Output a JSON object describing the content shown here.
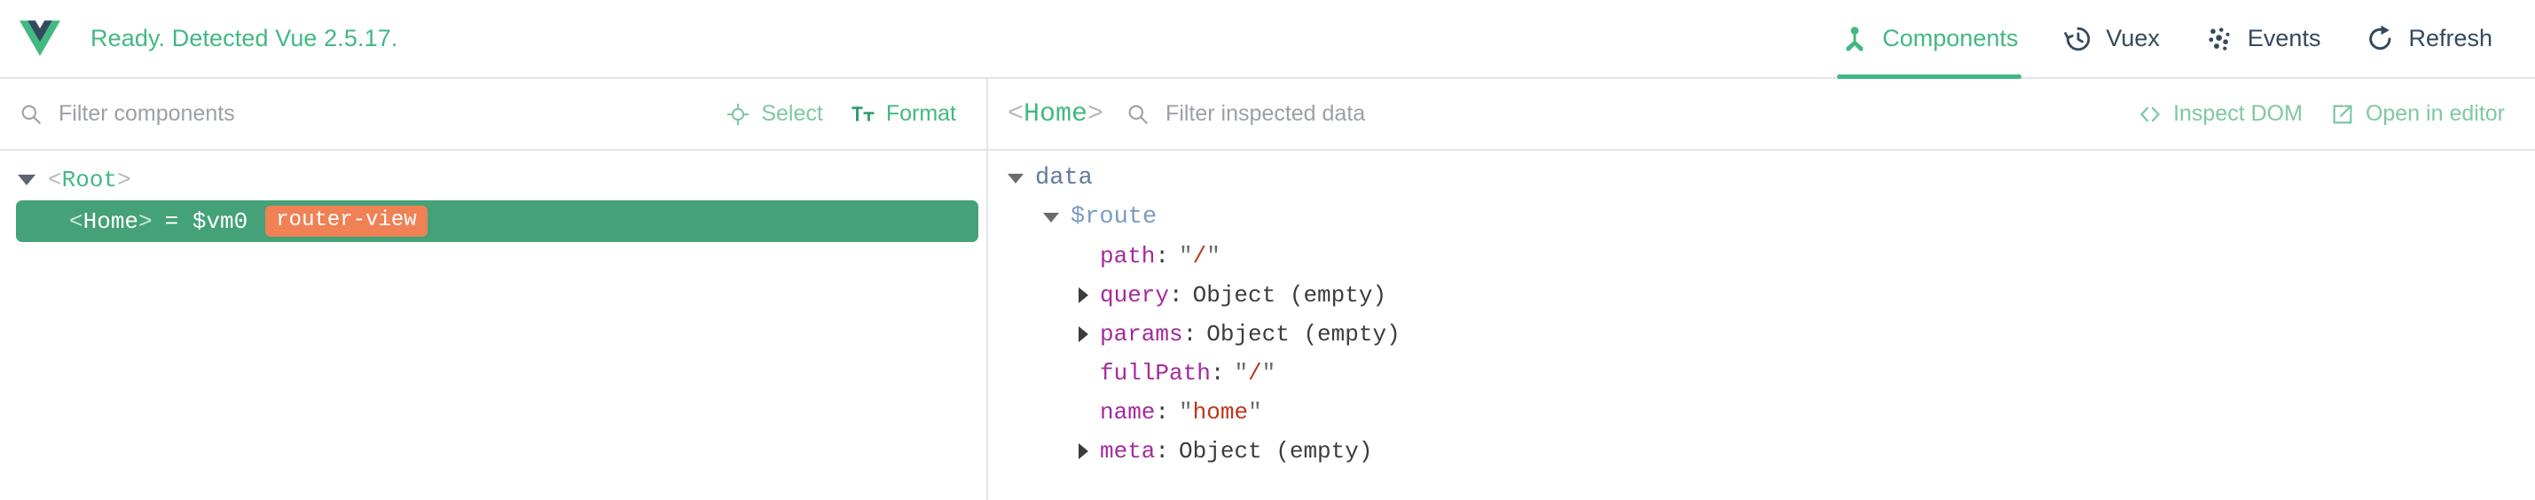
{
  "header": {
    "logo_icon": "vue-logo-icon",
    "status": "Ready. Detected Vue 2.5.17.",
    "tabs": [
      {
        "label": "Components",
        "icon": "component-tree-icon",
        "active": true
      },
      {
        "label": "Vuex",
        "icon": "history-clock-icon",
        "active": false
      },
      {
        "label": "Events",
        "icon": "pulse-dots-icon",
        "active": false
      },
      {
        "label": "Refresh",
        "icon": "refresh-icon",
        "active": false
      }
    ]
  },
  "left_panel": {
    "toolbar": {
      "search_icon": "search-icon",
      "search_placeholder": "Filter components",
      "search_value": "",
      "select_label": "Select",
      "select_icon": "target-crosshair-icon",
      "format_label": "Format",
      "format_icon": "text-format-icon"
    },
    "tree": [
      {
        "name": "Root",
        "open_tag": "<",
        "close_tag": ">",
        "expanded": true,
        "selected": false,
        "depth": 0,
        "vm": "",
        "badge": ""
      },
      {
        "name": "Home",
        "open_tag": "<",
        "close_tag": ">",
        "expanded": false,
        "selected": true,
        "depth": 1,
        "vm": "= $vm0",
        "badge": "router-view"
      }
    ]
  },
  "right_panel": {
    "toolbar": {
      "inspected_open": "<",
      "inspected_name": "Home",
      "inspected_close": ">",
      "search_icon": "search-icon",
      "search_placeholder": "Filter inspected data",
      "search_value": "",
      "inspect_dom_label": "Inspect DOM",
      "inspect_dom_icon": "code-brackets-icon",
      "open_in_editor_label": "Open in editor",
      "open_in_editor_icon": "external-link-icon"
    },
    "groups": [
      {
        "label": "data",
        "expanded": true
      },
      {
        "label": "$route",
        "expanded": true
      }
    ],
    "properties": [
      {
        "key": "path",
        "colon": ":",
        "value": "\"/\"",
        "raw": "/",
        "type": "string",
        "expandable": false
      },
      {
        "key": "query",
        "colon": ":",
        "value": "Object (empty)",
        "raw": "",
        "type": "object",
        "expandable": true
      },
      {
        "key": "params",
        "colon": ":",
        "value": "Object (empty)",
        "raw": "",
        "type": "object",
        "expandable": true
      },
      {
        "key": "fullPath",
        "colon": ":",
        "value": "\"/\"",
        "raw": "/",
        "type": "string",
        "expandable": false
      },
      {
        "key": "name",
        "colon": ":",
        "value": "\"home\"",
        "raw": "home",
        "type": "string",
        "expandable": false
      },
      {
        "key": "meta",
        "colon": ":",
        "value": "Object (empty)",
        "raw": "",
        "type": "object",
        "expandable": true
      }
    ]
  },
  "colors": {
    "vue_green": "#42b883",
    "vue_navy": "#35495e",
    "selected_row": "#44a178",
    "badge_orange": "#f08155",
    "key_purple": "#a52a9c",
    "string_red": "#c0341d",
    "group_blue": "#607d9b",
    "border_gray": "#e3e5e8"
  }
}
